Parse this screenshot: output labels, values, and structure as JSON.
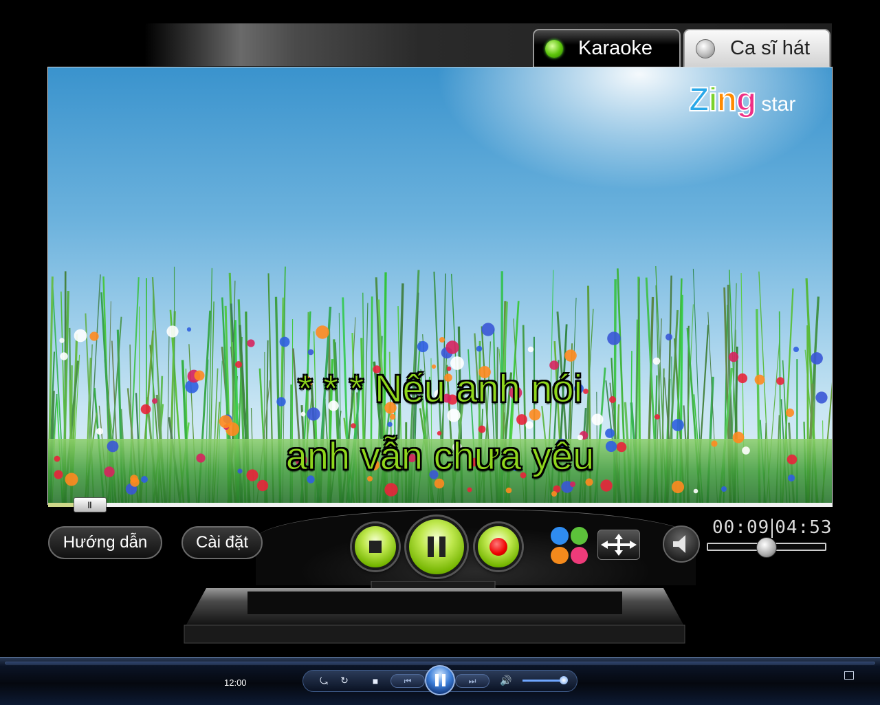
{
  "tabs": [
    {
      "label": "Karaoke",
      "active": true
    },
    {
      "label": "Ca sĩ hát",
      "active": false
    }
  ],
  "logo": {
    "brand": "Zing",
    "suffix": "star"
  },
  "lyrics": {
    "line1": "* * * Nếu anh nói",
    "line2": "anh vẫn chưa yêu"
  },
  "playback": {
    "elapsed": "00:09",
    "total": "04:53",
    "progress_fraction": 0.032
  },
  "controls": {
    "guide_label": "Hướng dẫn",
    "settings_label": "Cài đặt",
    "volume_fraction": 0.5
  },
  "colors": {
    "lyric": "#8fd61c",
    "accent_green": "#74b400",
    "record_red": "#e00000",
    "dots": [
      "#2f8cf0",
      "#5cc23a",
      "#f48a1c",
      "#ee3b7a"
    ]
  },
  "media_player": {
    "time": "12:00",
    "state": "playing",
    "volume_fraction": 0.9,
    "icons": [
      "shuffle-icon",
      "repeat-icon",
      "stop-icon",
      "previous-icon",
      "pause-icon",
      "next-icon",
      "speaker-icon",
      "switch-to-now-playing-icon"
    ]
  }
}
